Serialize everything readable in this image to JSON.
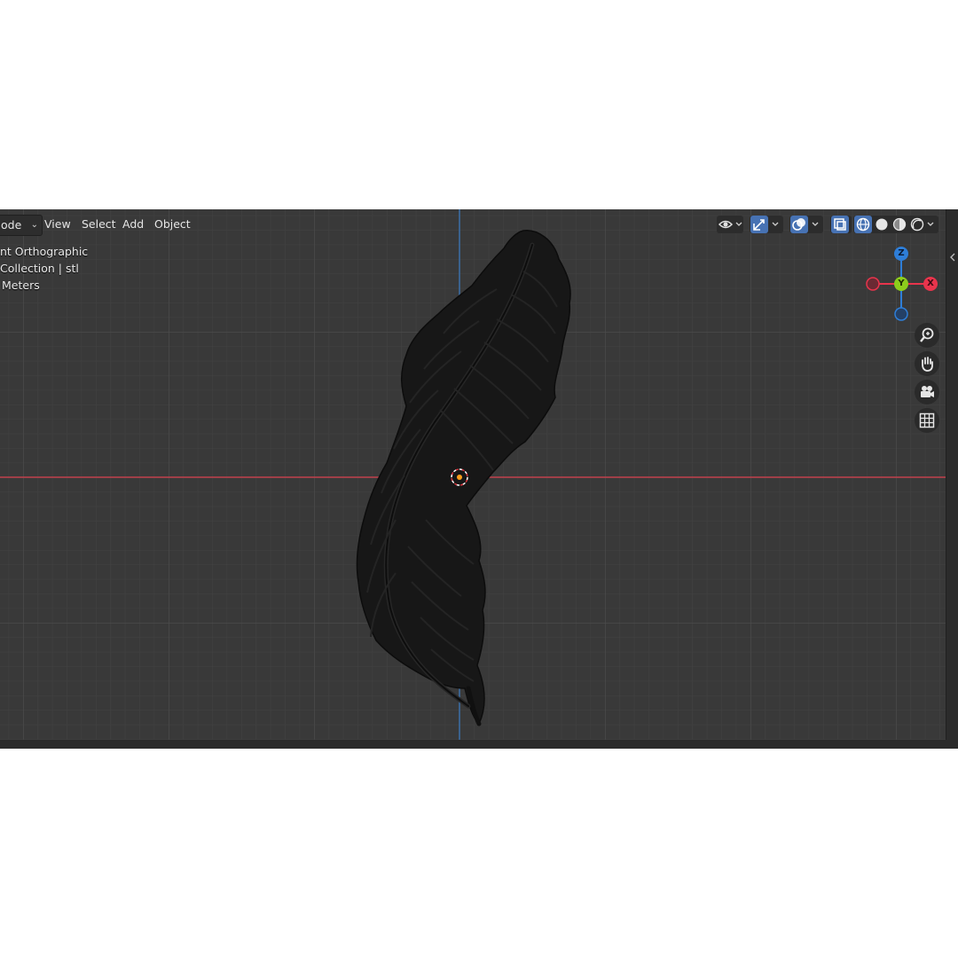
{
  "header": {
    "mode_label": "ode",
    "menus": [
      "View",
      "Select",
      "Add",
      "Object"
    ]
  },
  "overlay": {
    "view_name": "nt Orthographic",
    "collection": "Collection | stl",
    "units": "Meters"
  },
  "gizmo": {
    "x_label": "X",
    "y_label": "Y",
    "z_label": "Z",
    "x_color": "#e8344c",
    "y_color": "#8ccc1c",
    "z_color": "#2e7ed8"
  },
  "nav_icons": [
    "zoom-icon",
    "hand-pan-icon",
    "camera-icon",
    "grid-perspective-icon"
  ],
  "colors": {
    "viewport_bg": "#393939",
    "x_axis_line": "#c0404c",
    "y_axis_line": "#3a6fa8",
    "feather": "#161616"
  }
}
